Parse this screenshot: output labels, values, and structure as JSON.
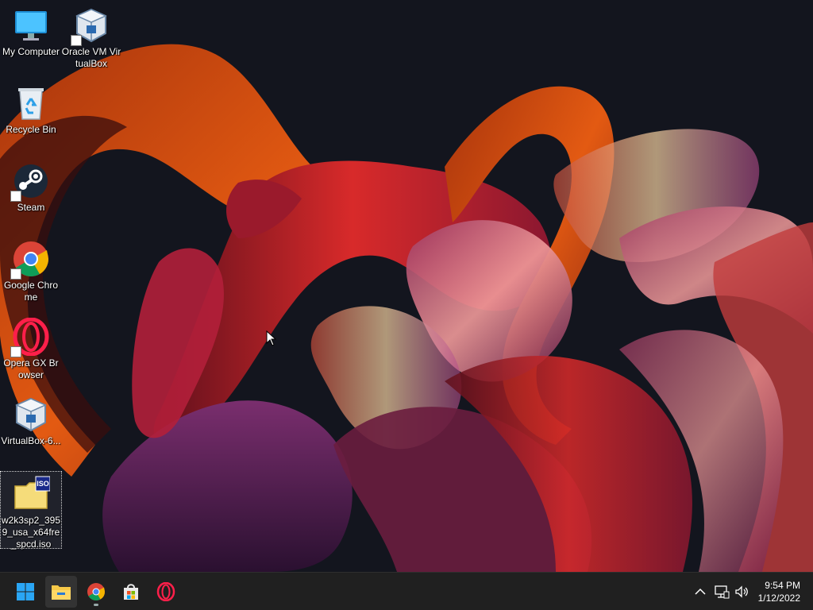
{
  "desktop": {
    "icons": [
      {
        "label": "My Computer",
        "icon": "monitor-icon"
      },
      {
        "label": "Oracle VM VirtualBox",
        "icon": "virtualbox-icon"
      },
      {
        "label": "Recycle Bin",
        "icon": "recycle-bin-icon"
      },
      {
        "label": "Steam",
        "icon": "steam-icon"
      },
      {
        "label": "Google Chrome",
        "icon": "chrome-icon"
      },
      {
        "label": "Opera GX Browser",
        "icon": "opera-gx-icon"
      },
      {
        "label": "VirtualBox-6...",
        "icon": "virtualbox-installer-icon"
      },
      {
        "label": "w2k3sp2_3959_usa_x64fre_spcd.iso",
        "icon": "iso-file-icon",
        "badge": "ISO"
      }
    ]
  },
  "taskbar": {
    "apps": [
      {
        "name": "Start",
        "icon": "windows-start-icon"
      },
      {
        "name": "File Explorer",
        "icon": "file-explorer-icon"
      },
      {
        "name": "Google Chrome",
        "icon": "chrome-icon"
      },
      {
        "name": "Microsoft Store",
        "icon": "store-icon"
      },
      {
        "name": "Opera GX",
        "icon": "opera-gx-icon"
      }
    ],
    "tray": {
      "time": "9:54 PM",
      "date": "1/12/2022",
      "icons": [
        "chevron-up-icon",
        "network-icon",
        "volume-icon"
      ]
    }
  },
  "colors": {
    "taskbar_bg": "#202020",
    "wallpaper_bg": "#13151e",
    "accent_blue": "#2aa6f5"
  }
}
